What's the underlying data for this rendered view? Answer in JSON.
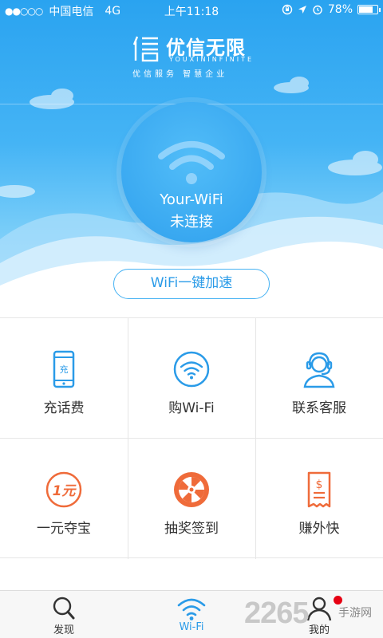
{
  "status_bar": {
    "signal_dots": "●●○○○",
    "carrier": "中国电信",
    "network": "4G",
    "time": "上午11:18",
    "battery_text": "78%",
    "battery_level": 0.78
  },
  "brand": {
    "name": "优信无限",
    "name_en": "YOUXININFINITE",
    "slogan": "优信服务 智慧企业"
  },
  "wifi": {
    "ssid": "Your-WiFi",
    "status": "未连接"
  },
  "accelerate_button": "WiFi一键加速",
  "features": [
    {
      "label": "充话费",
      "icon": "phone-recharge-icon",
      "glyph": "充"
    },
    {
      "label": "购Wi-Fi",
      "icon": "wifi-purchase-icon"
    },
    {
      "label": "联系客服",
      "icon": "customer-service-icon"
    },
    {
      "label": "一元夺宝",
      "icon": "one-yuan-treasure-icon",
      "glyph": "1元"
    },
    {
      "label": "抽奖签到",
      "icon": "lottery-wheel-icon"
    },
    {
      "label": "赚外快",
      "icon": "earn-extra-icon",
      "glyph": "$"
    }
  ],
  "tabs": [
    {
      "label": "发现",
      "icon": "search-icon"
    },
    {
      "label": "Wi-Fi",
      "icon": "wifi-icon",
      "active": true
    },
    {
      "label": "我的",
      "icon": "user-icon"
    }
  ],
  "watermark": {
    "number": "2265",
    "text": "手游网"
  },
  "colors": {
    "primary": "#2a9be8",
    "hero_top": "#2aa3f0",
    "orange_accent": "#ef6b3a",
    "badge_red": "#e60012"
  }
}
